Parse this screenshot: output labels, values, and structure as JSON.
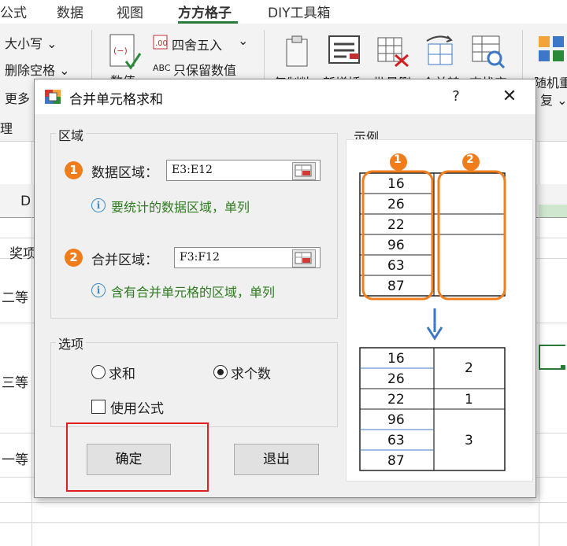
{
  "app": {
    "tabs": [
      "公式",
      "数据",
      "视图",
      "方方格子",
      "DIY工具箱"
    ],
    "ribbon": {
      "case_label": "大小写 ⌄",
      "remove_space_label": "删除空格 ⌄",
      "more_label": "更多",
      "manage_label": "理",
      "round_label": "四舍五入",
      "keep_value_label": "只保留数值",
      "numeric_label": "数值",
      "copy_label": "复制粘",
      "insert_label": "新增插",
      "batch_delete_label": "批量删",
      "merge_label": "合并转",
      "find_label": "查找定",
      "random_label": "随机重",
      "repeat_label": "复 ⌄"
    },
    "sheet": {
      "col_d": "D",
      "cells": [
        "奖项",
        "二等",
        "三等",
        "一等"
      ]
    }
  },
  "dialog": {
    "title": "合并单元格求和",
    "help": "?",
    "close": "✕",
    "region_group": "区域",
    "data_range_label": "数据区域：",
    "data_range_value": "E3:E12",
    "data_range_hint": "要统计的数据区域，单列",
    "merge_range_label": "合并区域：",
    "merge_range_value": "F3:F12",
    "merge_range_hint": "含有合并单元格的区域，单列",
    "badge1": "1",
    "badge2": "2",
    "info": "i",
    "options_group": "选项",
    "option_sum": "求和",
    "option_count": "求个数",
    "selected_option": "求个数",
    "use_formula": "使用公式",
    "use_formula_checked": false,
    "ok": "确定",
    "exit": "退出",
    "example_group": "示例",
    "example": {
      "data_values": [
        "16",
        "26",
        "22",
        "96",
        "63",
        "87"
      ],
      "result_values": [
        "2",
        "1",
        "3"
      ]
    }
  },
  "colors": {
    "accent_orange": "#f07d1b",
    "hint_green": "#2e7b1f",
    "highlight_red": "#e02020",
    "arrow_blue": "#3d77c8"
  }
}
